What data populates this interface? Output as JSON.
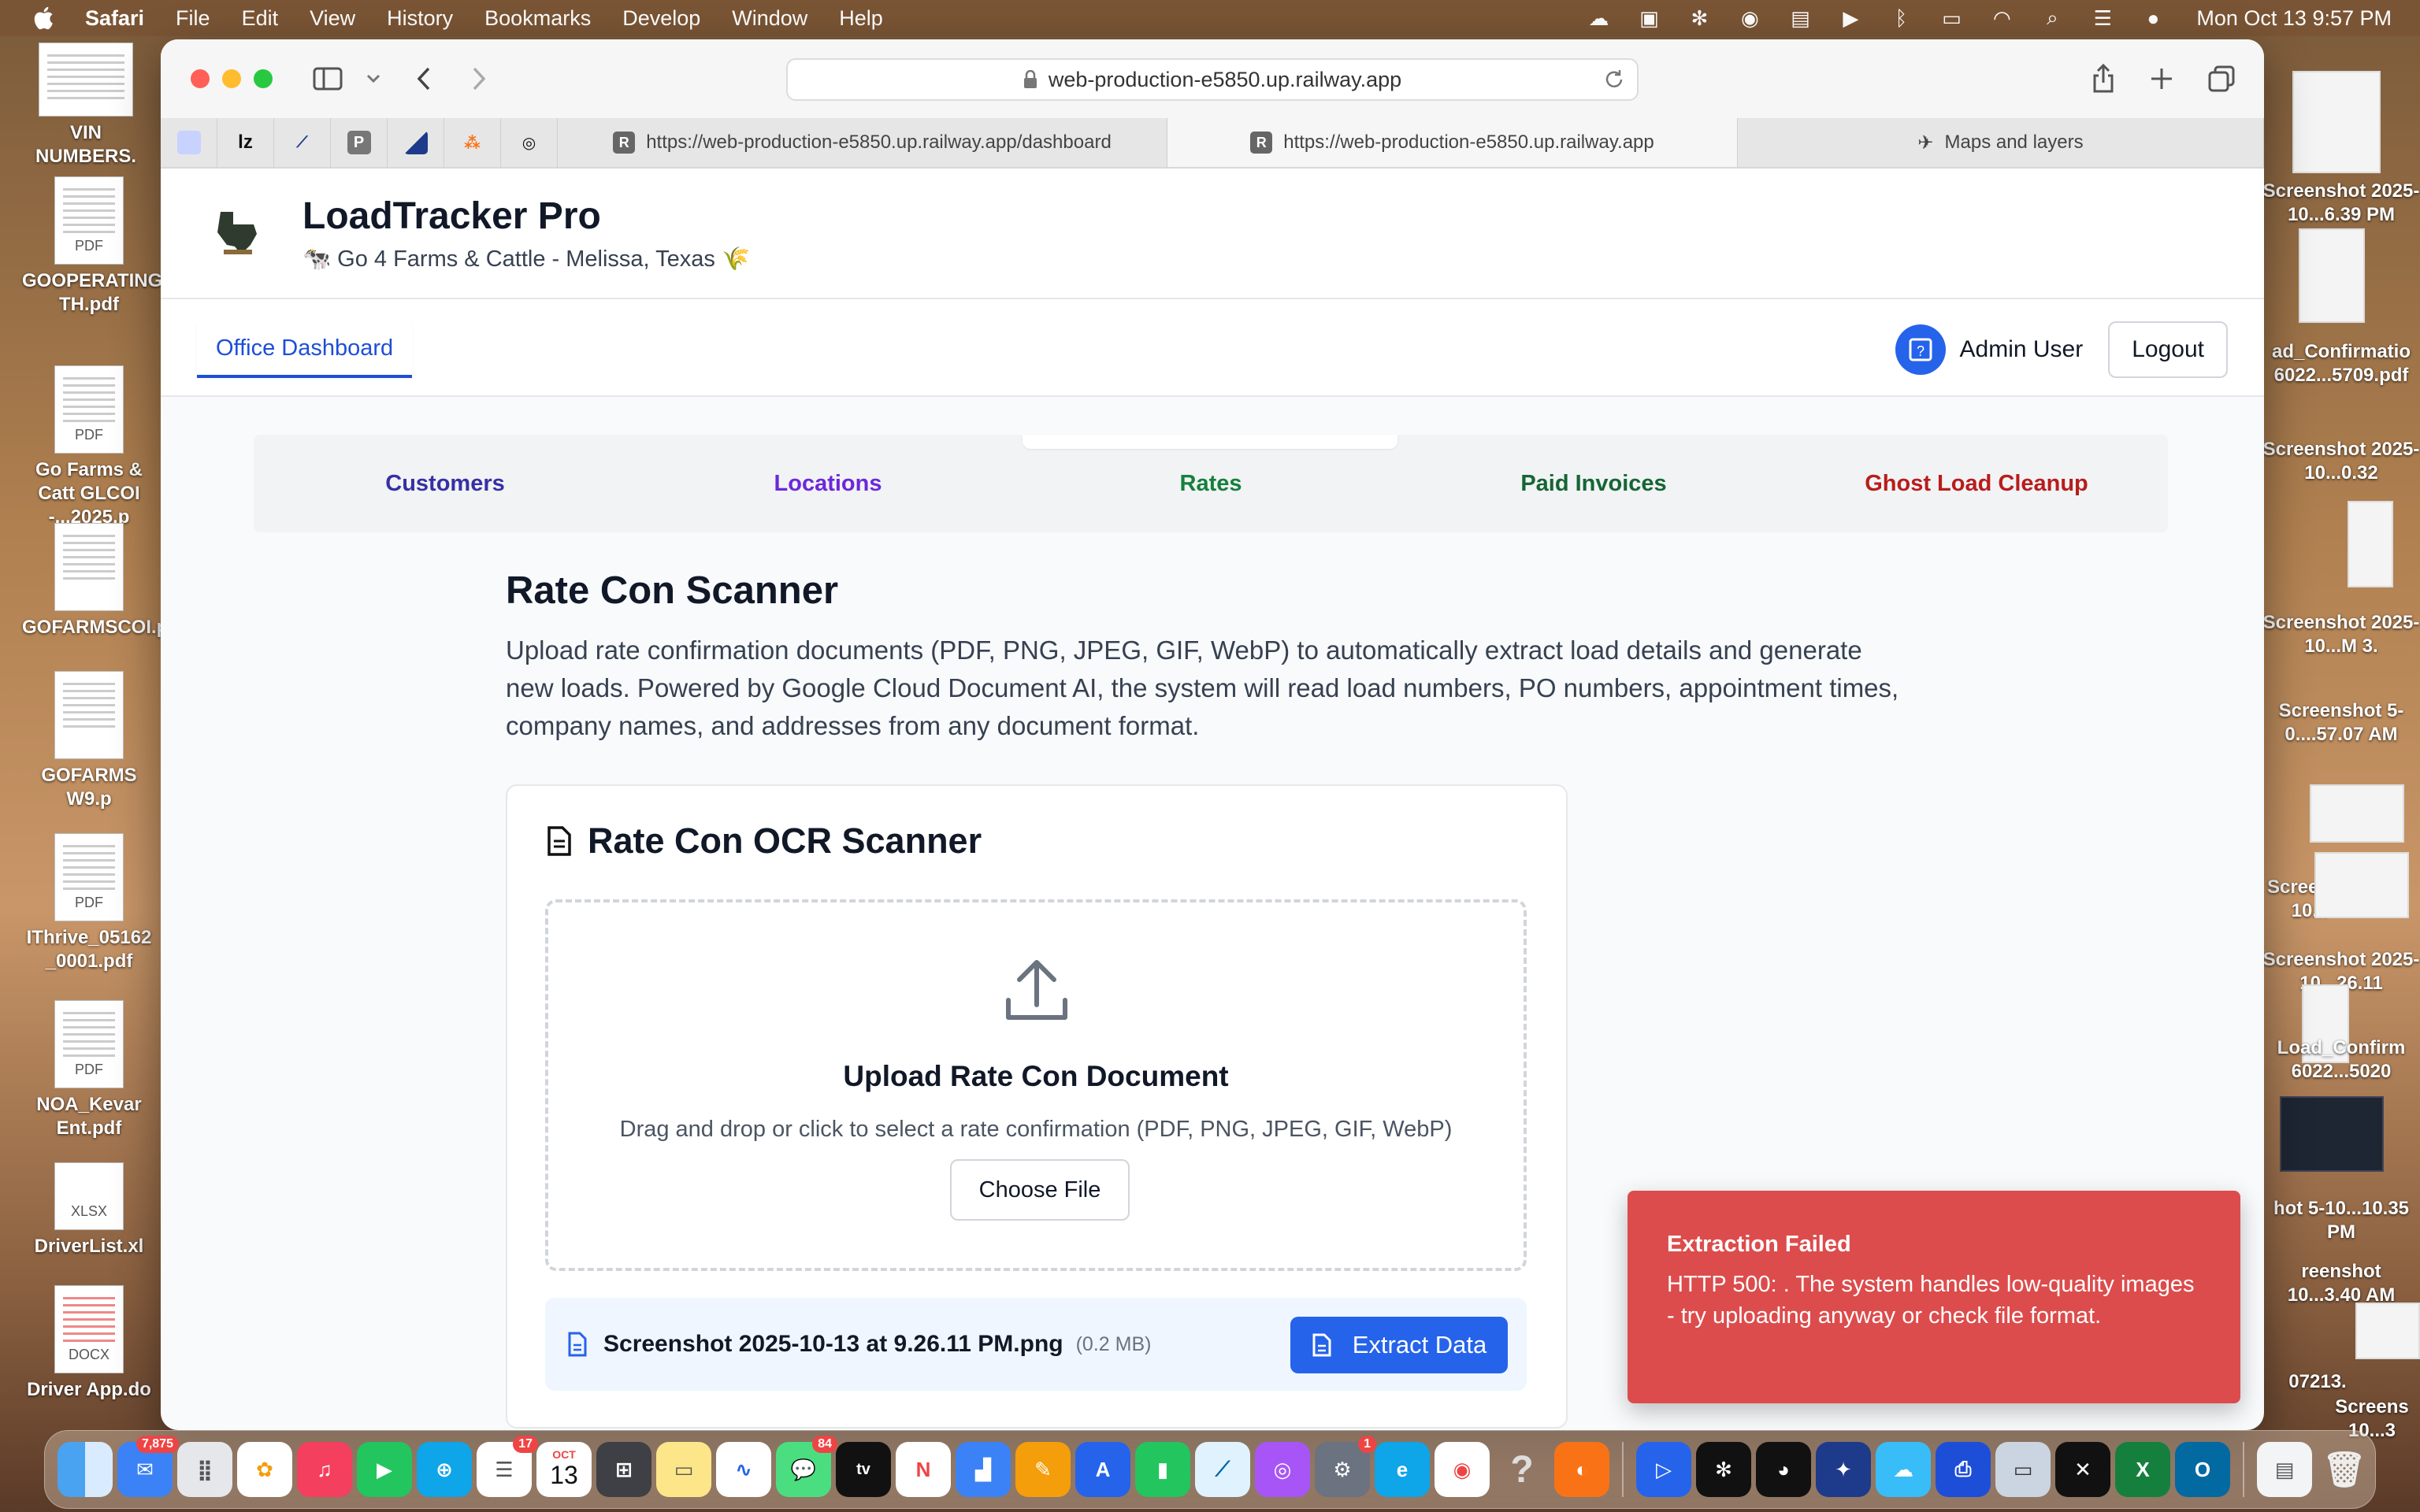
{
  "menubar": {
    "app": "Safari",
    "items": [
      "File",
      "Edit",
      "View",
      "History",
      "Bookmarks",
      "Develop",
      "Window",
      "Help"
    ],
    "clock": "Mon Oct 13  9:57 PM"
  },
  "desktop_left": [
    {
      "label": "VIN NUMBERS.",
      "tag": ""
    },
    {
      "label": "GOOPERATING TH.pdf",
      "tag": "PDF"
    },
    {
      "label": "Go Farms & Catt GLCOI -...2025.p",
      "tag": "PDF"
    },
    {
      "label": "GOFARMSCOI.p",
      "tag": ""
    },
    {
      "label": "GOFARMS W9.p",
      "tag": ""
    },
    {
      "label": "IThrive_05162 _0001.pdf",
      "tag": "PDF"
    },
    {
      "label": "NOA_Kevar Ent.pdf",
      "tag": "PDF"
    },
    {
      "label": "DriverList.xl",
      "tag": "XLSX"
    },
    {
      "label": "Driver App.do",
      "tag": "DOCX"
    }
  ],
  "desktop_right": [
    {
      "label": "Screenshot 2025-10...6.39 PM"
    },
    {
      "label": "ad_Confirmatio 6022...5709.pdf"
    },
    {
      "label": "Screenshot 2025-10...0.32"
    },
    {
      "label": "Screenshot 2025-10...M 3."
    },
    {
      "label": "Screenshot 5-0....57.07 AM"
    },
    {
      "label": "Screen 5-10..."
    },
    {
      "label": "Screenshot 2025-10...26.11"
    },
    {
      "label": "Load_Confirm 6022...5020"
    },
    {
      "label": "hot 5-10...10.35 PM"
    },
    {
      "label": "reenshot 10...3.40 AM"
    },
    {
      "label": "07213."
    },
    {
      "label": "Screens 10...3"
    }
  ],
  "browser": {
    "url": "web-production-e5850.up.railway.app",
    "tabs": [
      {
        "label": "https://web-production-e5850.up.railway.app/dashboard",
        "favicon": "R",
        "active": false
      },
      {
        "label": "https://web-production-e5850.up.railway.app",
        "favicon": "R",
        "active": true
      },
      {
        "label": "Maps and layers",
        "favicon": "",
        "active": false
      }
    ],
    "pinned": [
      "",
      "lz",
      "",
      "P",
      "",
      "",
      ""
    ]
  },
  "app": {
    "title": "LoadTracker Pro",
    "subtitle": "🐄 Go 4 Farms & Cattle - Melissa, Texas 🌾",
    "nav_tab": "Office Dashboard",
    "user_name": "Admin User",
    "logout": "Logout",
    "subnav": [
      {
        "label": "Customers",
        "color": "#3730a3"
      },
      {
        "label": "Locations",
        "color": "#6d28d9"
      },
      {
        "label": "Rates",
        "color": "#15803d"
      },
      {
        "label": "Paid Invoices",
        "color": "#166534"
      },
      {
        "label": "Ghost Load Cleanup",
        "color": "#b91c1c"
      }
    ]
  },
  "page": {
    "title": "Rate Con Scanner",
    "description": "Upload rate confirmation documents (PDF, PNG, JPEG, GIF, WebP) to automatically extract load details and generate new loads. Powered by Google Cloud Document AI, the system will read load numbers, PO numbers, appointment times, company names, and addresses from any document format."
  },
  "scanner": {
    "card_title": "Rate Con OCR Scanner",
    "dropzone_title": "Upload Rate Con Document",
    "dropzone_sub": "Drag and drop or click to select a rate confirmation (PDF, PNG, JPEG, GIF, WebP)",
    "choose_file": "Choose File",
    "file_name": "Screenshot 2025-10-13 at 9.26.11 PM.png",
    "file_size": "(0.2 MB)",
    "extract_button": "Extract Data"
  },
  "toast": {
    "title": "Extraction Failed",
    "message": "HTTP 500: . The system handles low-quality images - try uploading anyway or check file format."
  },
  "dock": {
    "badges": {
      "mail": "7,875",
      "reminders": "17",
      "messages": "84",
      "settings": "1"
    },
    "calendar_month": "OCT",
    "calendar_day": "13"
  },
  "colors": {
    "accent": "#2563eb",
    "toast": "#dc4c4c"
  }
}
